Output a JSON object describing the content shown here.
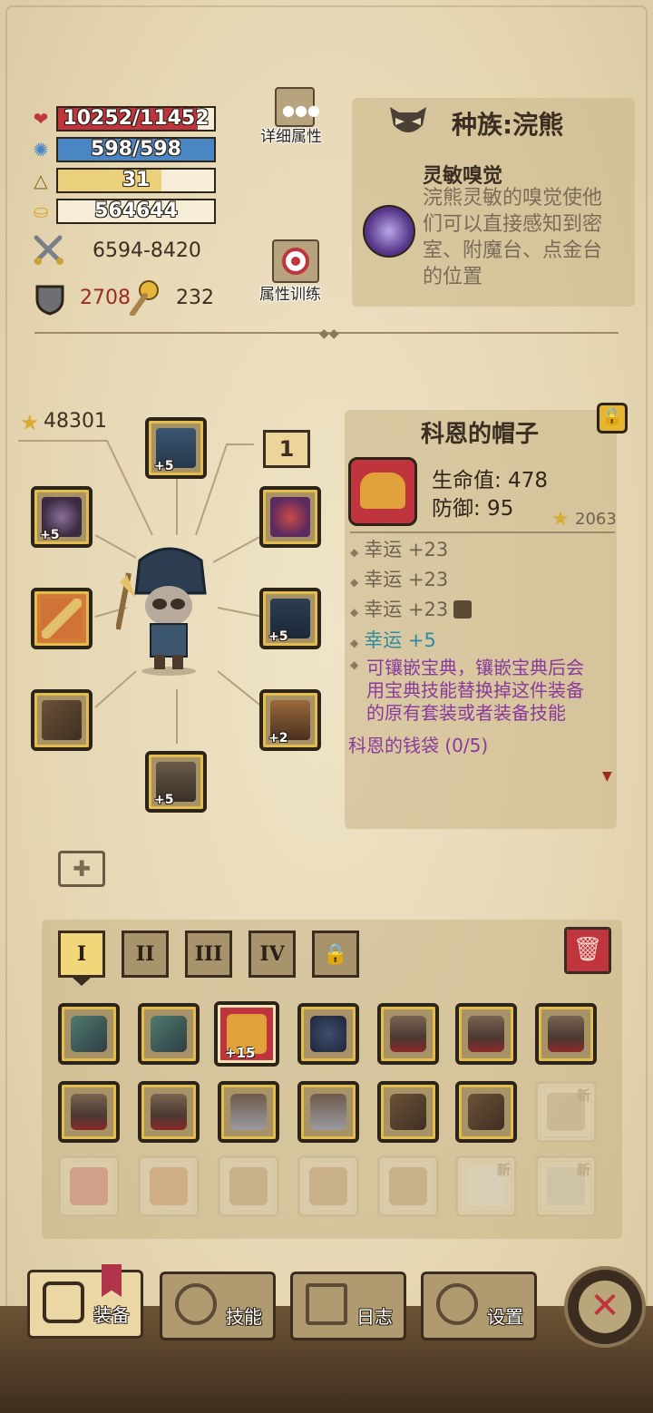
{
  "stats": {
    "hp": "10252/11452",
    "hp_fraction": 0.895,
    "mana": "598/598",
    "mana_fraction": 1.0,
    "level": "31",
    "level_fraction": 0.66,
    "gold": "564644",
    "attack": "6594-8420",
    "defense": "2708",
    "luck": "232"
  },
  "buttons": {
    "detail_attrs": "详细属性",
    "attr_training": "属性训练"
  },
  "race": {
    "title": "种族:浣熊",
    "skill_name": "灵敏嗅觉",
    "skill_desc_lines": [
      "浣熊灵敏的嗅觉使他",
      "们可以直接感知到密",
      "室、附魔台、点金台",
      "的位置"
    ]
  },
  "equipment": {
    "score": "48301",
    "slot_badge": "1",
    "plus": {
      "helmet": "+5",
      "ring": "+5",
      "cape": "+5",
      "pants": "+2",
      "boots": "+5"
    }
  },
  "item": {
    "name": "科恩的帽子",
    "hp_label": "生命值: 478",
    "def_label": "防御: 95",
    "score": "2063",
    "affixes": [
      "幸运 +23",
      "幸运 +23",
      "幸运 +23",
      "幸运 +5"
    ],
    "socket_note_lines": [
      "可镶嵌宝典，镶嵌宝典后会",
      "用宝典技能替换掉这件装备",
      "的原有套装或者装备技能"
    ],
    "set_name": "科恩的钱袋 (0/5)"
  },
  "inventory": {
    "tabs": [
      "I",
      "II",
      "III",
      "IV"
    ],
    "selected_plus": "+15",
    "new_label": "新"
  },
  "nav": {
    "equip": "装备",
    "skills": "技能",
    "log": "日志",
    "settings": "设置"
  },
  "colors": {
    "hp": "#c0353d",
    "mana": "#4a86c4",
    "level": "#ead07a",
    "purple": "#8a3a9c",
    "teal": "#2d8aa0"
  }
}
